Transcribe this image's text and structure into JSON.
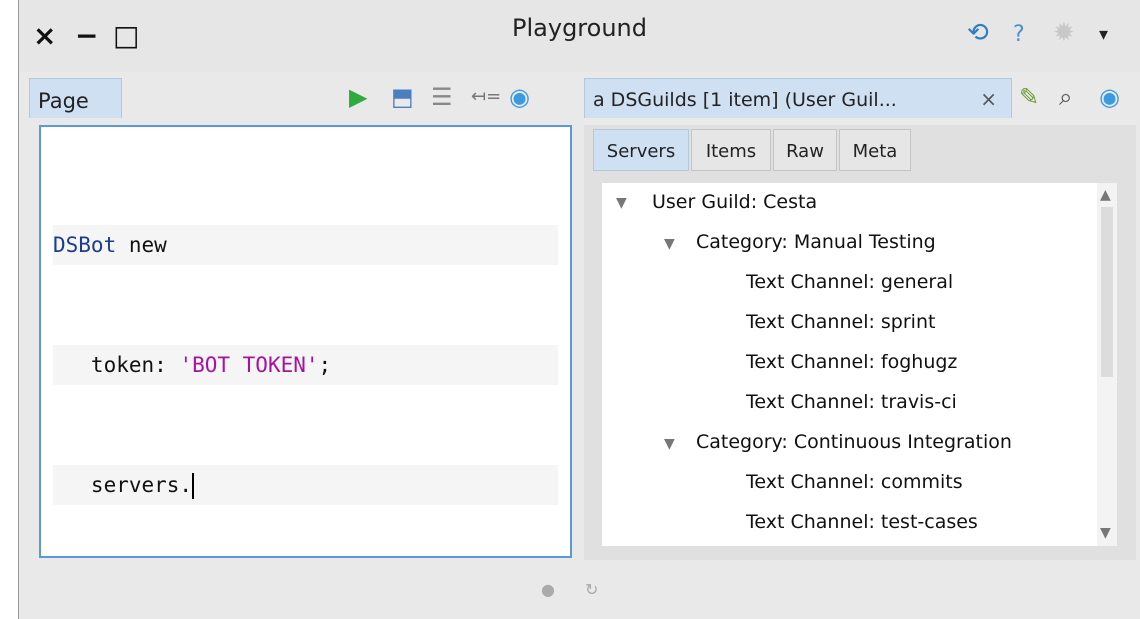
{
  "window": {
    "title": "Playground",
    "controls": {
      "close": "×",
      "minimize": "−",
      "maximize": "□"
    },
    "right_icons": [
      "sync-icon",
      "help-icon",
      "settings-gear-icon",
      "menu-down-icon"
    ],
    "help_label": "?"
  },
  "left_pane": {
    "tab_label": "Page",
    "toolbar_icons": [
      "play-icon",
      "export-icon",
      "bindings-icon",
      "assign-icon",
      "remote-icon"
    ],
    "code_lines": [
      {
        "cls": "DSBot",
        "rest": " new"
      },
      {
        "pre": "   token: ",
        "str": "'BOT TOKEN'",
        "post": ";"
      },
      {
        "pre": "   servers."
      }
    ]
  },
  "right_pane": {
    "tab_label": "a DSGuilds [1 item] (User Guil...",
    "close": "×",
    "toolbar_icons": [
      "edit-icon",
      "search-icon",
      "remote-icon"
    ],
    "sub_tabs": [
      "Servers",
      "Items",
      "Raw",
      "Meta"
    ],
    "active_sub_tab": "Servers",
    "tree": [
      {
        "label": "User Guild: Cesta",
        "level": 0,
        "expanded": true
      },
      {
        "label": "Category: Manual Testing",
        "level": 1,
        "expanded": true
      },
      {
        "label": "Text Channel: general",
        "level": 2
      },
      {
        "label": "Text Channel: sprint",
        "level": 2
      },
      {
        "label": "Text Channel: foghugz",
        "level": 2
      },
      {
        "label": "Text Channel: travis-ci",
        "level": 2
      },
      {
        "label": "Category: Continuous Integration",
        "level": 1,
        "expanded": true
      },
      {
        "label": "Text Channel: commits",
        "level": 2
      },
      {
        "label": "Text Channel: test-cases",
        "level": 2
      }
    ]
  },
  "status_bar": {
    "icons": [
      "dot-icon",
      "refresh-icon"
    ]
  },
  "colors": {
    "accent": "#5b9bd5",
    "tab_active": "#cfe0f3",
    "string": "#a3159e",
    "class": "#1c3c8c",
    "play": "#2eaa3e"
  }
}
